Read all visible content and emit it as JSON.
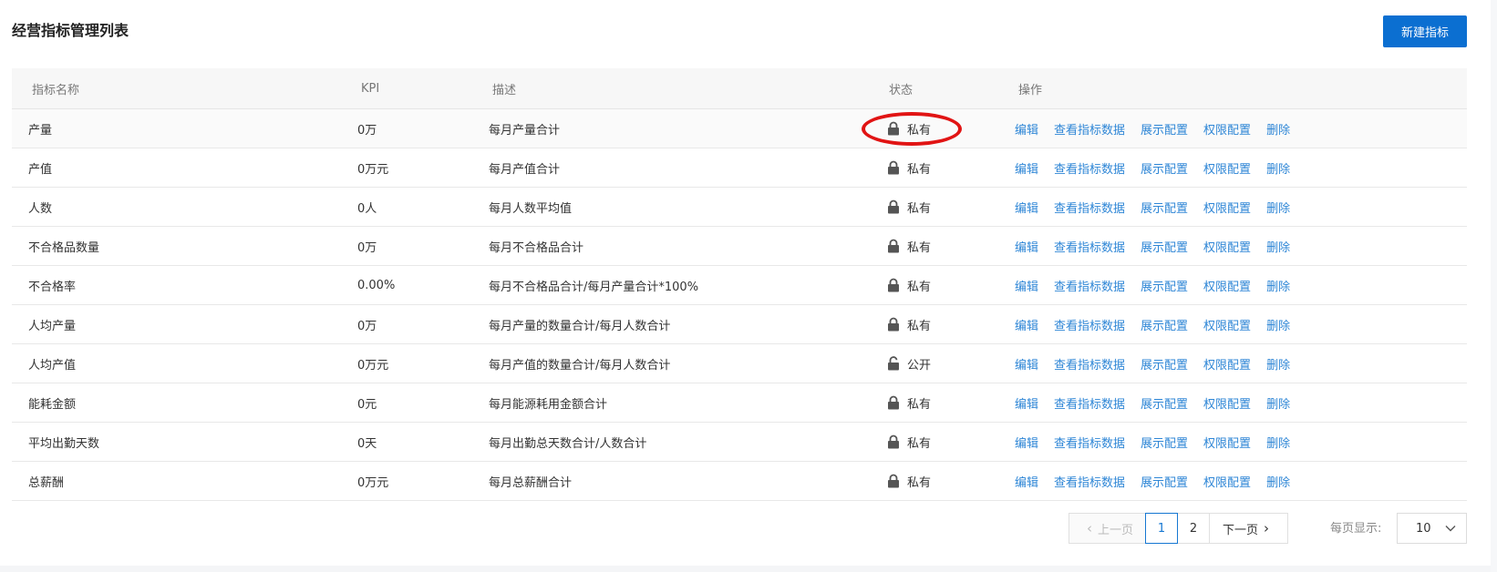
{
  "page": {
    "title": "经营指标管理列表",
    "new_button": "新建指标"
  },
  "table": {
    "columns": [
      "指标名称",
      "KPI",
      "描述",
      "状态",
      "操作"
    ],
    "rows": [
      {
        "name": "产量",
        "kpi": "0万",
        "desc": "每月产量合计",
        "status": "私有",
        "locked": true
      },
      {
        "name": "产值",
        "kpi": "0万元",
        "desc": "每月产值合计",
        "status": "私有",
        "locked": true
      },
      {
        "name": "人数",
        "kpi": "0人",
        "desc": "每月人数平均值",
        "status": "私有",
        "locked": true
      },
      {
        "name": "不合格品数量",
        "kpi": "0万",
        "desc": "每月不合格品合计",
        "status": "私有",
        "locked": true
      },
      {
        "name": "不合格率",
        "kpi": "0.00%",
        "desc": "每月不合格品合计/每月产量合计*100%",
        "status": "私有",
        "locked": true
      },
      {
        "name": "人均产量",
        "kpi": "0万",
        "desc": "每月产量的数量合计/每月人数合计",
        "status": "私有",
        "locked": true
      },
      {
        "name": "人均产值",
        "kpi": "0万元",
        "desc": "每月产值的数量合计/每月人数合计",
        "status": "公开",
        "locked": false
      },
      {
        "name": "能耗金额",
        "kpi": "0元",
        "desc": "每月能源耗用金额合计",
        "status": "私有",
        "locked": true
      },
      {
        "name": "平均出勤天数",
        "kpi": "0天",
        "desc": "每月出勤总天数合计/人数合计",
        "status": "私有",
        "locked": true
      },
      {
        "name": "总薪酬",
        "kpi": "0万元",
        "desc": "每月总薪酬合计",
        "status": "私有",
        "locked": true
      }
    ],
    "actions": [
      "编辑",
      "查看指标数据",
      "展示配置",
      "权限配置",
      "删除"
    ]
  },
  "pagination": {
    "prev_label": "上一页",
    "pages": [
      "1",
      "2"
    ],
    "current_page": "1",
    "next_label": "下一页",
    "page_size_label": "每页显示:",
    "page_size": "10"
  },
  "colors": {
    "primary": "#0b6fd1",
    "link": "#2e86d6",
    "annotation": "#e11414"
  }
}
